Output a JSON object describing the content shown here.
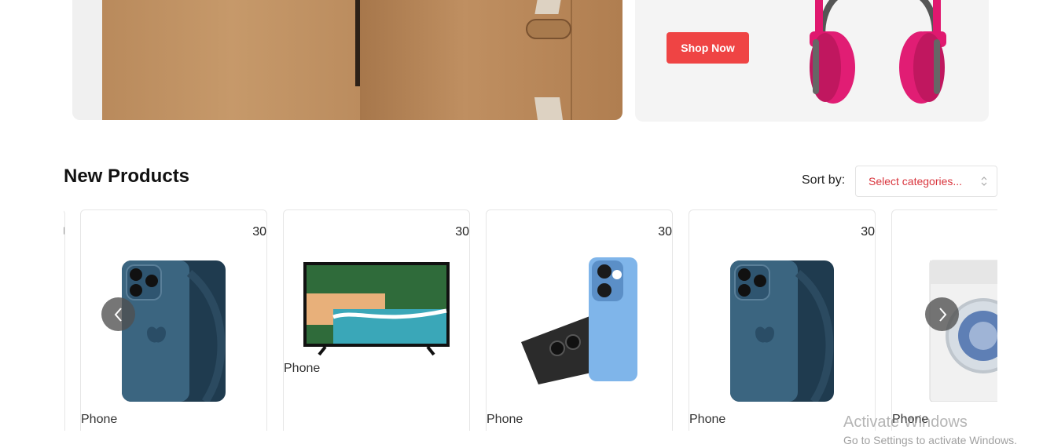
{
  "banner": {
    "shop_now_label": "Shop Now",
    "accent_color": "#ef4444"
  },
  "section": {
    "title": "New Products",
    "sort_label": "Sort by:",
    "sort_select_value": "Select categories..."
  },
  "products": [
    {
      "price": "30",
      "name": "Phone",
      "image": "iphone-blue"
    },
    {
      "price": "30",
      "name": "Phone",
      "image": "television"
    },
    {
      "price": "30",
      "name": "Phone",
      "image": "smartphone-light-blue"
    },
    {
      "price": "30",
      "name": "Phone",
      "image": "iphone-blue"
    },
    {
      "price": "",
      "name": "Phone",
      "image": "washing-machine"
    }
  ],
  "carousel": {
    "prev_icon": "chevron-left-icon",
    "next_icon": "chevron-right-icon"
  },
  "watermark": {
    "title": "Activate Windows",
    "subtitle": "Go to Settings to activate Windows."
  }
}
